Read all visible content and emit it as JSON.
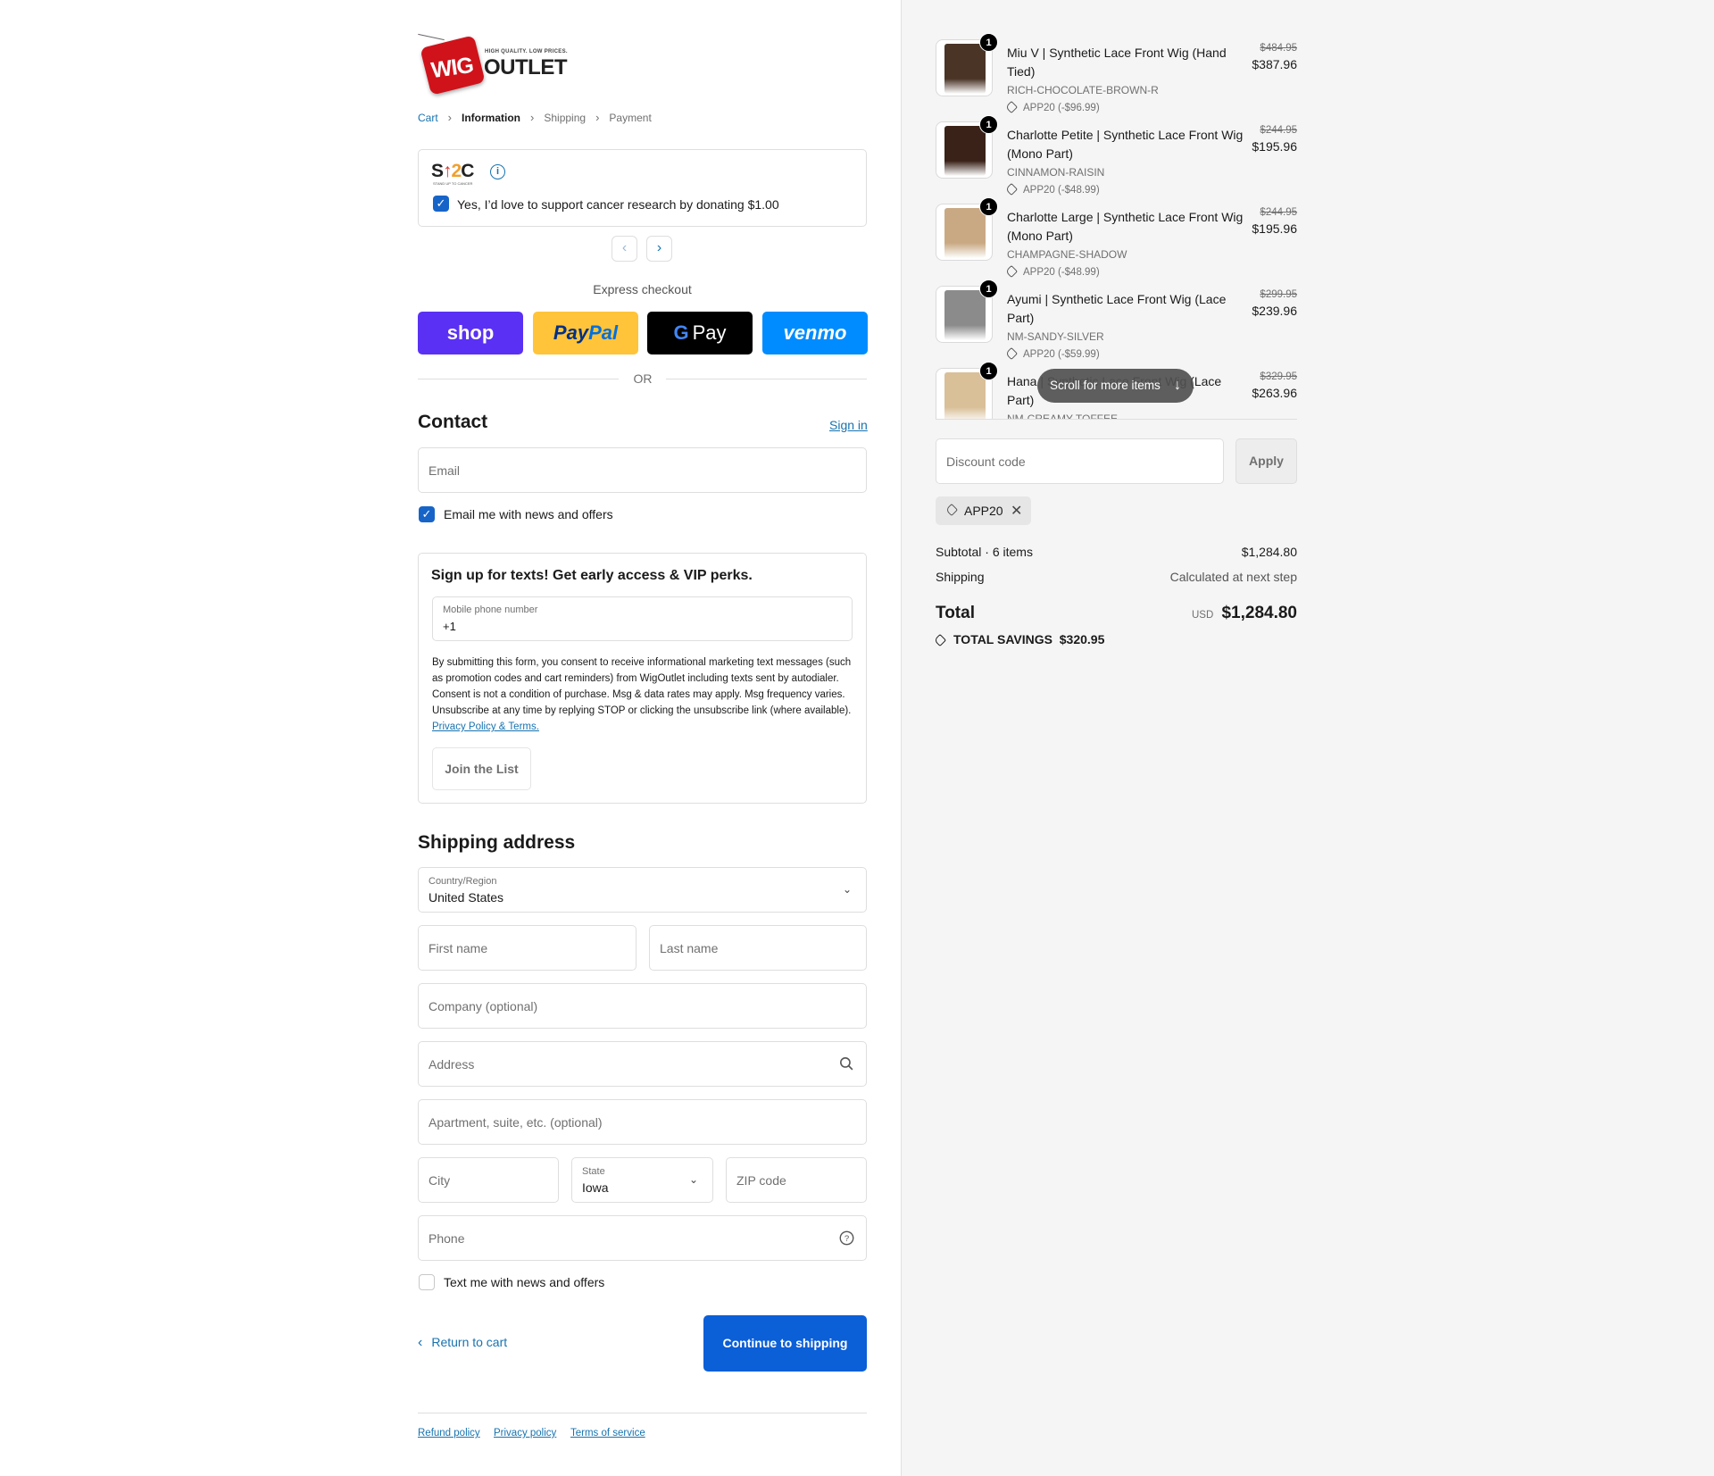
{
  "brand": {
    "logo_main": "WIG",
    "logo_second": "OUTLET",
    "logo_tagline": "HIGH QUALITY. LOW PRICES."
  },
  "breadcrumb": {
    "cart": "Cart",
    "information": "Information",
    "shipping": "Shipping",
    "payment": "Payment"
  },
  "donation": {
    "logo_text": "SU2C",
    "logo_sub": "STAND UP TO CANCER",
    "checkbox_label": "Yes, I’d love to support cancer research by donating $1.00",
    "checked": true
  },
  "express": {
    "label": "Express checkout",
    "shop": "shop",
    "paypal_a": "Pay",
    "paypal_b": "Pal",
    "gpay_g": "G",
    "gpay_text": "Pay",
    "venmo": "venmo",
    "or": "OR"
  },
  "contact": {
    "title": "Contact",
    "sign_in": "Sign in",
    "email_placeholder": "Email",
    "news_label": "Email me with news and offers"
  },
  "sms": {
    "title": "Sign up for texts! Get early access & VIP perks.",
    "phone_label": "Mobile phone number",
    "phone_value": "+1",
    "legal": "By submitting this form, you consent to receive informational marketing text messages (such as promotion codes and cart reminders) from WigOutlet including texts sent by autodialer. Consent is not a condition of purchase. Msg & data rates may apply. Msg frequency varies. Unsubscribe at any time by replying STOP or clicking the unsubscribe link (where available).",
    "legal_link": "Privacy Policy & Terms.",
    "join": "Join the List"
  },
  "shipping": {
    "title": "Shipping address",
    "country_label": "Country/Region",
    "country_value": "United States",
    "first_name": "First name",
    "last_name": "Last name",
    "company": "Company (optional)",
    "address": "Address",
    "apartment": "Apartment, suite, etc. (optional)",
    "city": "City",
    "state_label": "State",
    "state_value": "Iowa",
    "zip": "ZIP code",
    "phone": "Phone",
    "text_label": "Text me with news and offers"
  },
  "actions": {
    "return": "Return to cart",
    "continue": "Continue to shipping"
  },
  "footer": {
    "refund": "Refund policy",
    "privacy": "Privacy policy",
    "terms": "Terms of service"
  },
  "order": {
    "items": [
      {
        "qty": "1",
        "name": "Miu V | Synthetic Lace Front Wig (Hand Tied)",
        "variant": "RICH-CHOCOLATE-BROWN-R",
        "discount": "APP20 (-$96.99)",
        "old_price": "$484.95",
        "price": "$387.96",
        "color": "#4a3426"
      },
      {
        "qty": "1",
        "name": "Charlotte Petite | Synthetic Lace Front Wig (Mono Part)",
        "variant": "CINNAMON-RAISIN",
        "discount": "APP20 (-$48.99)",
        "old_price": "$244.95",
        "price": "$195.96",
        "color": "#3a2218"
      },
      {
        "qty": "1",
        "name": "Charlotte Large | Synthetic Lace Front Wig (Mono Part)",
        "variant": "CHAMPAGNE-SHADOW",
        "discount": "APP20 (-$48.99)",
        "old_price": "$244.95",
        "price": "$195.96",
        "color": "#c9a984"
      },
      {
        "qty": "1",
        "name": "Ayumi | Synthetic Lace Front Wig (Lace Part)",
        "variant": "NM-SANDY-SILVER",
        "discount": "APP20 (-$59.99)",
        "old_price": "$299.95",
        "price": "$239.96",
        "color": "#8b8b8b"
      },
      {
        "qty": "1",
        "name": "Hana | Synthetic Lace Front Wig (Lace Part)",
        "variant": "NM-CREAMY-TOFFEE",
        "discount": "",
        "old_price": "$329.95",
        "price": "$263.96",
        "color": "#d9c099"
      }
    ],
    "scroll_hint": "Scroll for more items",
    "discount_placeholder": "Discount code",
    "apply": "Apply",
    "applied_code": "APP20",
    "subtotal_label": "Subtotal · 6 items",
    "subtotal_value": "$1,284.80",
    "shipping_label": "Shipping",
    "shipping_value": "Calculated at next step",
    "total_label": "Total",
    "currency": "USD",
    "total_value": "$1,284.80",
    "savings_label": "TOTAL SAVINGS",
    "savings_value": "$320.95"
  },
  "colors": {
    "accent": "#1773b0",
    "primary_button": "#0b5fd7",
    "shop_pay": "#5a31f4",
    "paypal": "#ffc439",
    "venmo": "#008cff"
  }
}
